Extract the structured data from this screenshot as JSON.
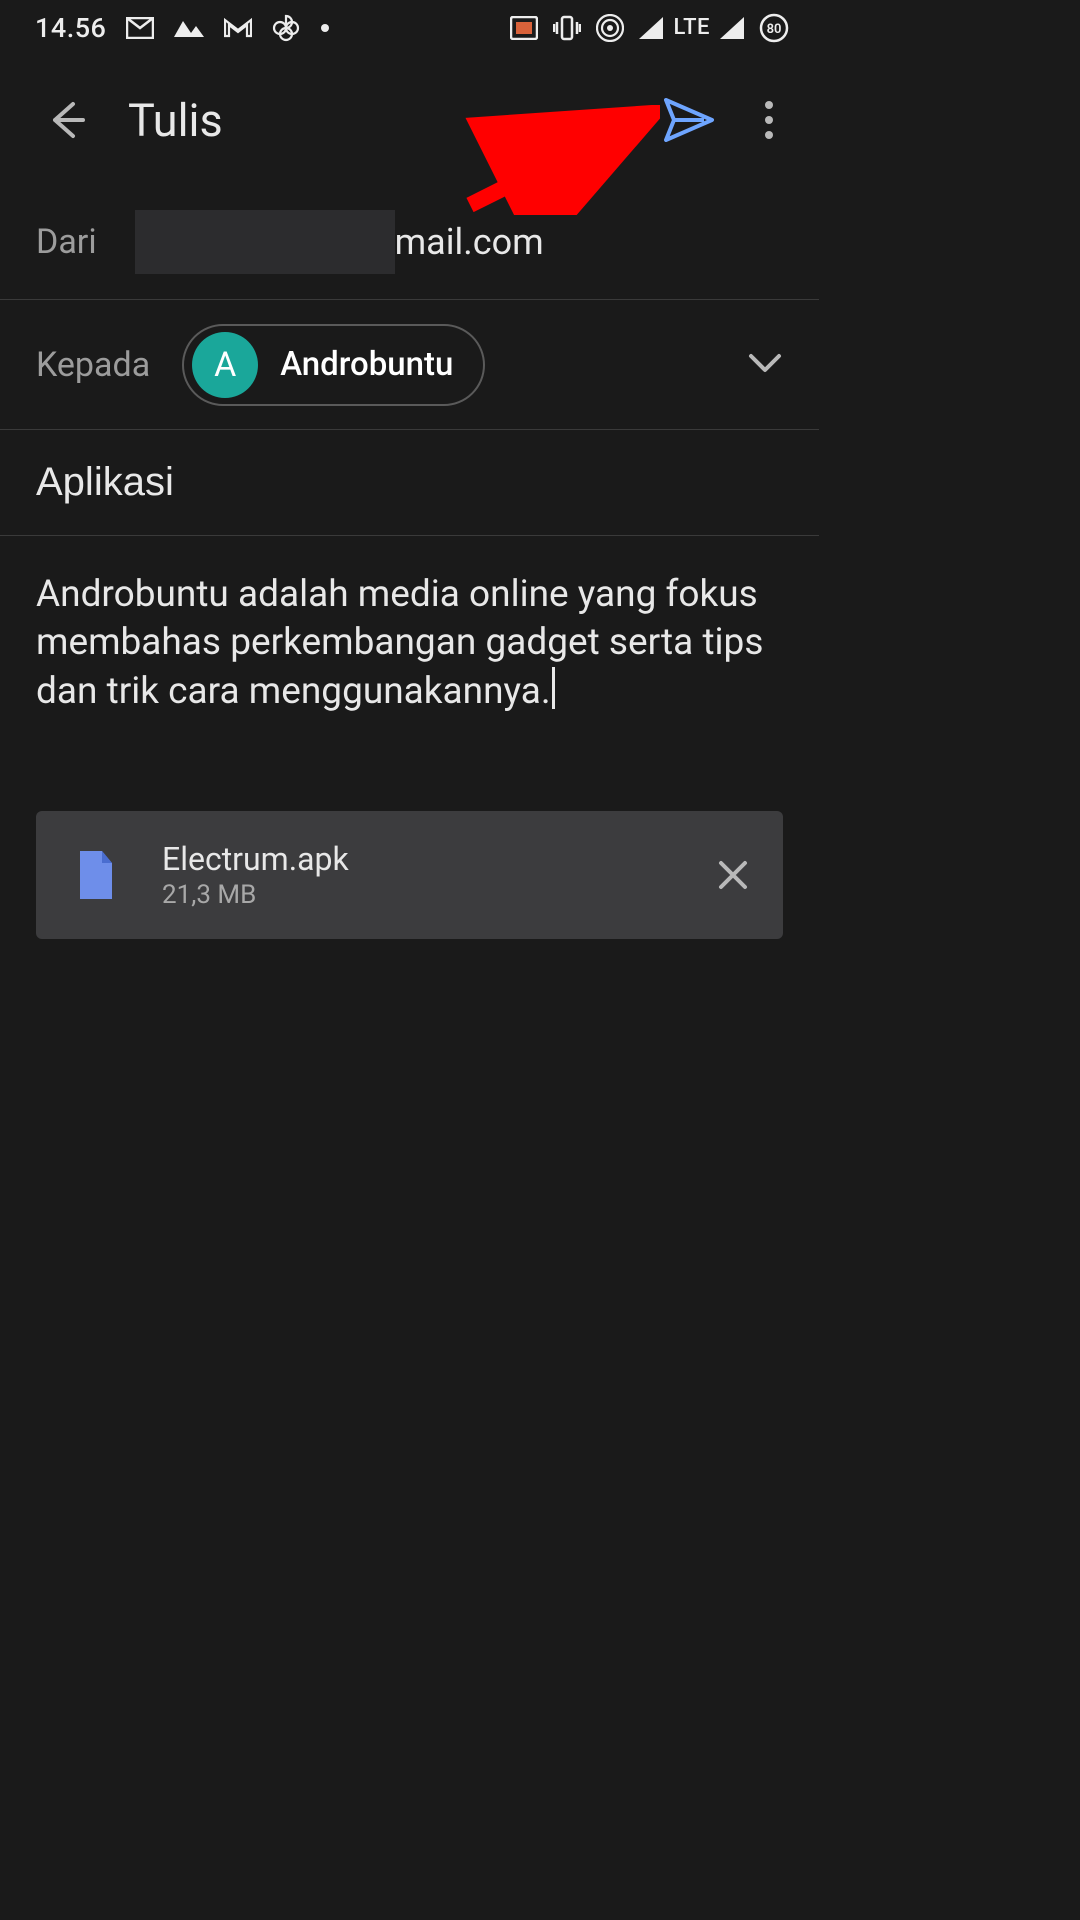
{
  "status": {
    "time": "14.56",
    "net": "LTE",
    "battery": "80"
  },
  "header": {
    "title": "Tulis"
  },
  "from": {
    "label": "Dari",
    "visible_tail": "mail.com"
  },
  "to": {
    "label": "Kepada",
    "chip": {
      "initial": "A",
      "name": "Androbuntu"
    }
  },
  "subject": {
    "value": "Aplikasi"
  },
  "body": {
    "text": "Androbuntu adalah media online yang fokus membahas perkembangan gadget serta tips dan trik cara menggunakannya."
  },
  "attachment": {
    "name": "Electrum.apk",
    "size": "21,3 MB"
  }
}
